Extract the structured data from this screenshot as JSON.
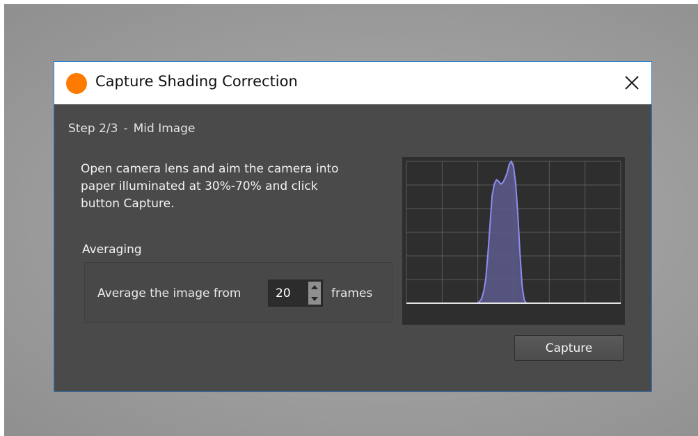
{
  "window": {
    "title": "Capture Shading Correction",
    "app_icon": "orange-circle-icon",
    "close_icon": "close-icon"
  },
  "step": {
    "number": "Step 2/3",
    "separator": "-",
    "name": "Mid Image"
  },
  "instructions": {
    "lines": [
      "Open camera lens and aim the camera into",
      "paper illuminated at 30%-70% and click",
      "button Capture."
    ]
  },
  "averaging": {
    "group_title": "Averaging",
    "label": "Average the image from",
    "value": "20",
    "unit": "frames"
  },
  "histogram": {
    "grid": true,
    "fill_color": "#5c5a8c",
    "line_color": "#8f8cf0",
    "axis_color": "#e6e6e6",
    "grid_color": "#5a5a5a"
  },
  "chart_data": {
    "type": "area",
    "x": [
      0.0,
      0.33,
      0.34,
      0.35,
      0.36,
      0.37,
      0.38,
      0.39,
      0.4,
      0.41,
      0.42,
      0.43,
      0.44,
      0.45,
      0.46,
      0.47,
      0.48,
      0.49,
      0.5,
      0.51,
      0.52,
      0.53,
      0.54,
      0.55,
      0.56,
      0.57,
      0.58,
      0.59,
      0.6,
      0.61,
      0.62,
      1.0
    ],
    "values": [
      0,
      0,
      0.01,
      0.03,
      0.08,
      0.17,
      0.34,
      0.55,
      0.76,
      0.84,
      0.87,
      0.86,
      0.84,
      0.85,
      0.88,
      0.92,
      0.98,
      1.0,
      0.96,
      0.84,
      0.62,
      0.35,
      0.12,
      0.02,
      0,
      0,
      0,
      0,
      0,
      0,
      0,
      0
    ],
    "xlim": [
      0,
      1
    ],
    "ylim": [
      0,
      1
    ],
    "grid": true
  },
  "buttons": {
    "capture": "Capture"
  }
}
